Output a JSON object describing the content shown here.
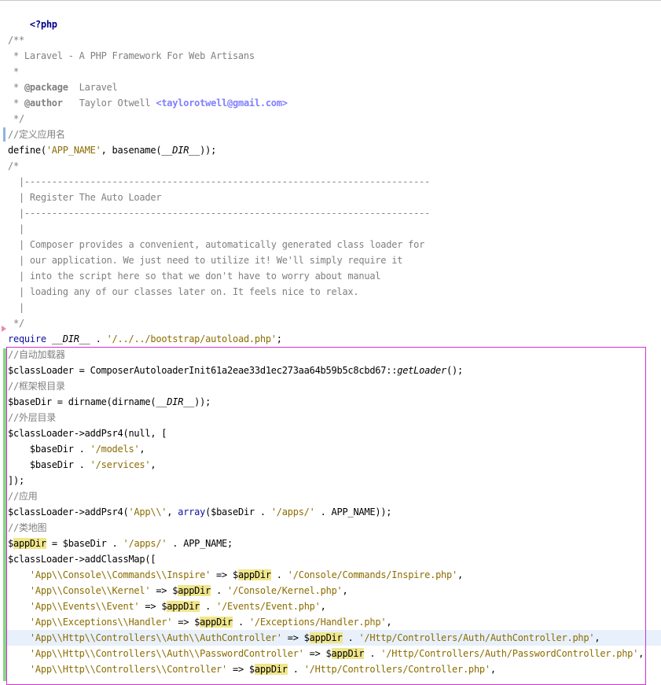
{
  "editor": {
    "php_open": "<?php",
    "doc_comment": {
      "open": "/**",
      "line1": " * Laravel - A PHP Framework For Web Artisans",
      "line2": " *",
      "package_prefix": " * ",
      "package_tag": "@package",
      "package_value": "  Laravel",
      "author_prefix": " * ",
      "author_tag": "@author",
      "author_value": "   Taylor Otwell ",
      "author_email": "<taylorotwell@gmail.com>",
      "close": " */"
    },
    "comment_app_name": "//定义应用名",
    "define_line": {
      "fn": "define(",
      "arg1": "'APP_NAME'",
      "mid": ", basename(",
      "dir": "__DIR__",
      "end": "));"
    },
    "block_comment": {
      "open": "/*",
      "sep1": "  |--------------------------------------------------------------------------",
      "title": "  | Register The Auto Loader",
      "sep2": "  |--------------------------------------------------------------------------",
      "blank1": "  |",
      "text1": "  | Composer provides a convenient, automatically generated class loader for",
      "text2": "  | our application. We just need to utilize it! We'll simply require it",
      "text3": "  | into the script here so that we don't have to worry about manual",
      "text4": "  | loading any of our classes later on. It feels nice to relax.",
      "blank2": "  |",
      "close": " */"
    },
    "require_line": {
      "kw": "require",
      "sp": " ",
      "dir": "__DIR__",
      "dot": " . ",
      "path": "'/../../bootstrap/autoload.php'",
      "end": ";"
    },
    "comment_autoloader": "//自动加载器",
    "classloader_line": {
      "var": "$classLoader",
      "mid": " = ComposerAutoloaderInit61a2eae33d1ec273aa64b59b5c8cbd67::",
      "method": "getLoader",
      "end": "();"
    },
    "comment_rootdir": "//框架根目录",
    "basedir_line": {
      "var": "$baseDir",
      "mid": " = dirname(dirname(",
      "dir": "__DIR__",
      "end": "));"
    },
    "comment_outer": "//外层目录",
    "psr4_line": {
      "var": "$classLoader",
      "mid": "->addPsr4(null, ["
    },
    "psr4_item1": {
      "indent": "    ",
      "var": "$baseDir",
      "dot": " . ",
      "str": "'/models'",
      "end": ","
    },
    "psr4_item2": {
      "indent": "    ",
      "var": "$baseDir",
      "dot": " . ",
      "str": "'/services'",
      "end": ","
    },
    "psr4_close": "]);",
    "comment_app": "//应用",
    "psr4_app_line": {
      "var": "$classLoader",
      "mid": "->addPsr4(",
      "str1": "'App\\\\'",
      "comma": ", ",
      "arr": "array",
      "rest1": "(",
      "var2": "$baseDir",
      "dot": " . ",
      "str2": "'/apps/'",
      "end": " . APP_NAME));"
    },
    "comment_classmap": "//类地图",
    "appdir_line": {
      "dollar": "$",
      "var": "appDir",
      "mid": " = ",
      "var2": "$baseDir",
      "dot": " . ",
      "str": "'/apps/'",
      "end": " . APP_NAME;"
    },
    "classmap_line": {
      "var": "$classLoader",
      "mid": "->addClassMap(["
    },
    "classmap_items": [
      {
        "key": "'App\\\\Console\\\\Commands\\\\Inspire'",
        "path": "'/Console/Commands/Inspire.php'"
      },
      {
        "key": "'App\\\\Console\\\\Kernel'",
        "path": "'/Console/Kernel.php'"
      },
      {
        "key": "'App\\\\Events\\\\Event'",
        "path": "'/Events/Event.php'"
      },
      {
        "key": "'App\\\\Exceptions\\\\Handler'",
        "path": "'/Exceptions/Handler.php'"
      },
      {
        "key": "'App\\\\Http\\\\Controllers\\\\Auth\\\\AuthController'",
        "path": "'/Http/Controllers/Auth/AuthController.php'"
      },
      {
        "key": "'App\\\\Http\\\\Controllers\\\\Auth\\\\PasswordController'",
        "path": "'/Http/Controllers/Auth/PasswordController.php'"
      },
      {
        "key": "'App\\\\Http\\\\Controllers\\\\Controller'",
        "path": "'/Http/Controllers/Controller.php'"
      }
    ],
    "classmap_arrow": " => ",
    "classmap_dollar": "$",
    "classmap_var": "appDir",
    "classmap_dot": " . ",
    "classmap_end": ",",
    "classmap_indent": "    "
  },
  "colors": {
    "keyword": "#00008b",
    "comment": "#808080",
    "string": "#8b6d00",
    "variable_highlight": "#f0e68c",
    "selection_border": "#cc33cc",
    "current_line": "#e8f0fc",
    "gutter_change": "#88d488"
  }
}
